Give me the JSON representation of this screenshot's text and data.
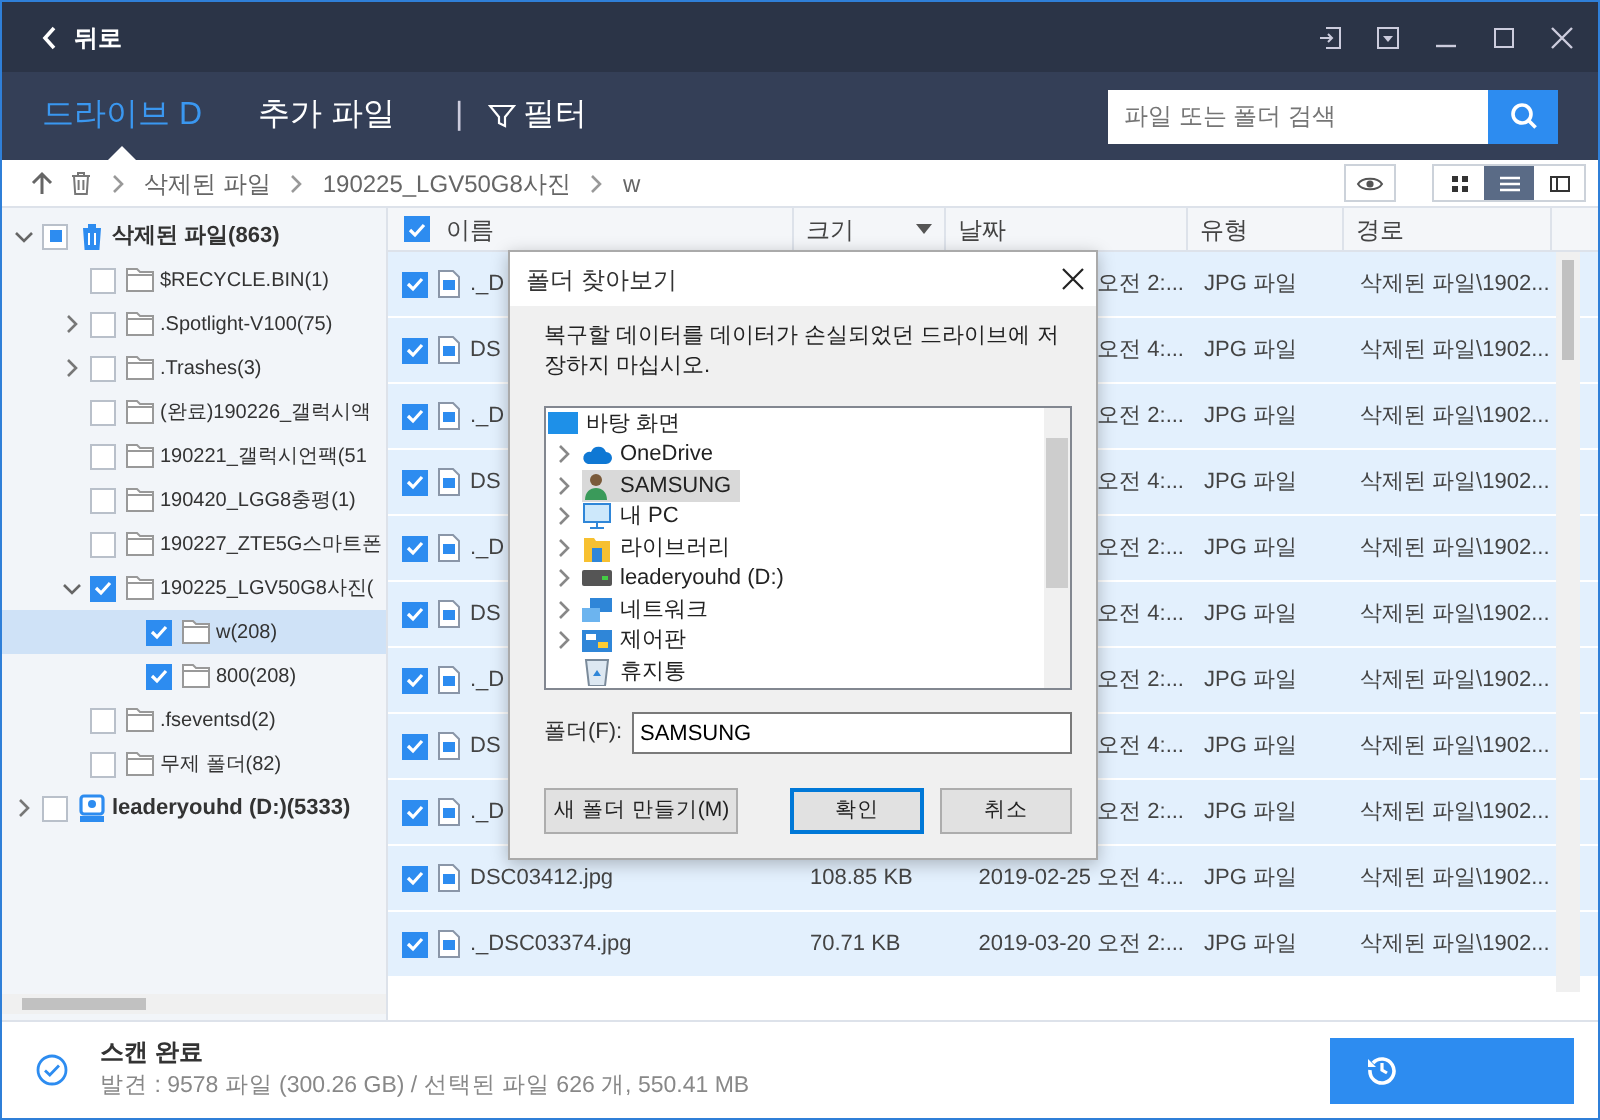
{
  "titlebar": {
    "back": "뒤로"
  },
  "nav": {
    "tabs": [
      {
        "label": "드라이브 D",
        "selected": true
      },
      {
        "label": "추가 파일",
        "selected": false
      }
    ],
    "separator": "|",
    "filter": "필터",
    "search": {
      "placeholder": "파일 또는 폴더 검색"
    }
  },
  "breadcrumb": [
    "삭제된 파일",
    "190225_LGV50G8사진",
    "w"
  ],
  "view_modes": [
    {
      "kind": "grid",
      "selected": false
    },
    {
      "kind": "list",
      "selected": true
    },
    {
      "kind": "detail",
      "selected": false
    }
  ],
  "tree": [
    {
      "label": "삭제된 파일(863)",
      "kind": "trash",
      "partial": true,
      "expanded": true,
      "selected": false,
      "children": [
        {
          "label": "$RECYCLE.BIN(1)",
          "kind": "folder",
          "checked": false,
          "selected": false
        },
        {
          "label": ".Spotlight-V100(75)",
          "kind": "folder",
          "checked": false,
          "expanded": false,
          "selected": false
        },
        {
          "label": ".Trashes(3)",
          "kind": "folder",
          "checked": false,
          "expanded": false,
          "selected": false
        },
        {
          "label": "(완료)190226_갤럭시액",
          "kind": "folder",
          "checked": false,
          "selected": false
        },
        {
          "label": "190221_갤럭시언팩(51",
          "kind": "folder",
          "checked": false,
          "selected": false
        },
        {
          "label": "190420_LGG8충평(1)",
          "kind": "folder",
          "checked": false,
          "selected": false
        },
        {
          "label": "190227_ZTE5G스마트폰",
          "kind": "folder",
          "checked": false,
          "selected": false
        },
        {
          "label": "190225_LGV50G8사진(",
          "kind": "folder",
          "checked": true,
          "expanded": true,
          "selected": false,
          "children": [
            {
              "label": "w(208)",
              "kind": "folder",
              "checked": true,
              "selected": true
            },
            {
              "label": "800(208)",
              "kind": "folder",
              "checked": true,
              "selected": false
            }
          ]
        },
        {
          "label": ".fseventsd(2)",
          "kind": "folder",
          "checked": false,
          "selected": false
        },
        {
          "label": "무제 폴더(82)",
          "kind": "folder",
          "checked": false,
          "selected": false
        }
      ]
    },
    {
      "label": "leaderyouhd (D:)(5333)",
      "kind": "drive",
      "checked": false,
      "expanded": false,
      "selected": false
    }
  ],
  "table": {
    "all_checked": true,
    "columns": [
      {
        "label": "이름",
        "sorted": false
      },
      {
        "label": "크기",
        "sorted": true
      },
      {
        "label": "날짜",
        "sorted": false
      },
      {
        "label": "유형",
        "sorted": false
      },
      {
        "label": "경로",
        "sorted": false
      }
    ],
    "rows": [
      {
        "checked": true,
        "name": "._D",
        "date": "오전 2:...",
        "type": "JPG 파일",
        "path": "삭제된 파일\\1902..."
      },
      {
        "checked": true,
        "name": "DS",
        "date": "오전 4:...",
        "type": "JPG 파일",
        "path": "삭제된 파일\\1902..."
      },
      {
        "checked": true,
        "name": "._D",
        "date": "오전 2:...",
        "type": "JPG 파일",
        "path": "삭제된 파일\\1902..."
      },
      {
        "checked": true,
        "name": "DS",
        "date": "오전 4:...",
        "type": "JPG 파일",
        "path": "삭제된 파일\\1902..."
      },
      {
        "checked": true,
        "name": "._D",
        "date": "오전 2:...",
        "type": "JPG 파일",
        "path": "삭제된 파일\\1902..."
      },
      {
        "checked": true,
        "name": "DS",
        "date": "오전 4:...",
        "type": "JPG 파일",
        "path": "삭제된 파일\\1902..."
      },
      {
        "checked": true,
        "name": "._D",
        "date": "오전 2:...",
        "type": "JPG 파일",
        "path": "삭제된 파일\\1902..."
      },
      {
        "checked": true,
        "name": "DS",
        "date": "오전 4:...",
        "type": "JPG 파일",
        "path": "삭제된 파일\\1902..."
      },
      {
        "checked": true,
        "name": "._D",
        "date": "오전 2:...",
        "type": "JPG 파일",
        "path": "삭제된 파일\\1902..."
      },
      {
        "checked": true,
        "name": "DSC03412.jpg",
        "size": "108.85 KB",
        "date": "2019-02-25 오전 4:...",
        "type": "JPG 파일",
        "path": "삭제된 파일\\1902..."
      },
      {
        "checked": true,
        "name": "._DSC03374.jpg",
        "size": "70.71 KB",
        "date": "2019-03-20 오전 2:...",
        "type": "JPG 파일",
        "path": "삭제된 파일\\1902..."
      }
    ]
  },
  "dialog": {
    "title": "폴더 찾아보기",
    "message": "복구할 데이터를 데이터가 손실되었던 드라이브에 저장하지 마십시오.",
    "tree": [
      {
        "label": "바탕 화면",
        "kind": "desktop",
        "selected": false,
        "children": [
          {
            "label": "OneDrive",
            "kind": "cloud",
            "expanded": false,
            "selected": false
          },
          {
            "label": "SAMSUNG",
            "kind": "user",
            "expanded": false,
            "selected": true
          },
          {
            "label": "내 PC",
            "kind": "pc",
            "expanded": false,
            "selected": false
          },
          {
            "label": "라이브러리",
            "kind": "library",
            "expanded": false,
            "selected": false
          },
          {
            "label": "leaderyouhd (D:)",
            "kind": "drive",
            "expanded": false,
            "selected": false
          },
          {
            "label": "네트워크",
            "kind": "network",
            "expanded": false,
            "selected": false
          },
          {
            "label": "제어판",
            "kind": "control",
            "expanded": false,
            "selected": false
          },
          {
            "label": "휴지통",
            "kind": "recycle",
            "selected": false
          }
        ]
      }
    ],
    "folder_label": "폴더(F):",
    "folder_value": "SAMSUNG",
    "buttons": [
      {
        "label": "새 폴더 만들기(M)",
        "kind": "new"
      },
      {
        "label": "확인",
        "kind": "default"
      },
      {
        "label": "취소",
        "kind": "normal"
      }
    ]
  },
  "status": {
    "title": "스캔 완료",
    "detail": "발견 : 9578 파일 (300.26 GB) / 선택된 파일 626 개, 550.41 MB"
  }
}
